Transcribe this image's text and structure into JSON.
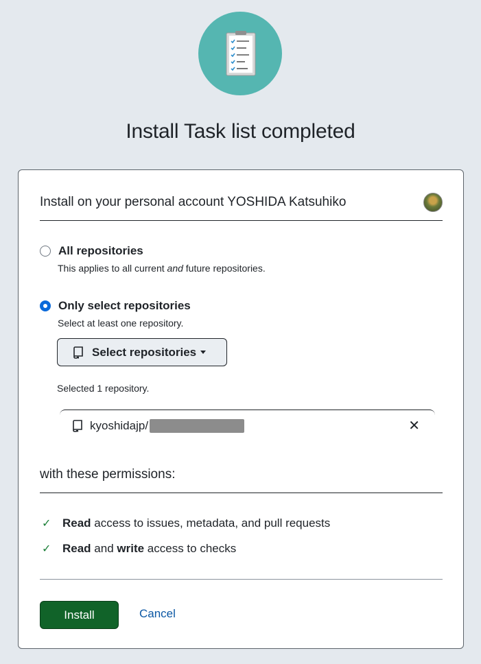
{
  "header": {
    "title": "Install Task list completed",
    "logo_icon": "clipboard-checklist-icon"
  },
  "account": {
    "label": "Install on your personal account YOSHIDA Katsuhiko"
  },
  "options": {
    "all": {
      "title": "All repositories",
      "desc_prefix": "This applies to all current ",
      "desc_em": "and",
      "desc_suffix": " future repositories.",
      "selected": false
    },
    "select": {
      "title": "Only select repositories",
      "desc": "Select at least one repository.",
      "selected": true
    }
  },
  "select_button": {
    "label": "Select repositories"
  },
  "selected_count": "Selected 1 repository.",
  "repos": [
    {
      "owner": "kyoshidajp/"
    }
  ],
  "permissions": {
    "heading": "with these permissions:",
    "items": [
      {
        "bold1": "Read",
        "mid": "",
        "bold2": "",
        "rest": " access to issues, metadata, and pull requests"
      },
      {
        "bold1": "Read",
        "mid": " and ",
        "bold2": "write",
        "rest": " access to checks"
      }
    ]
  },
  "actions": {
    "install": "Install",
    "cancel": "Cancel"
  },
  "colors": {
    "background": "#e4e9ee",
    "logo_bg": "#55b6b1",
    "primary": "#116329",
    "link": "#0b57a4",
    "radio_checked": "#0969da",
    "check": "#1a7f37"
  }
}
